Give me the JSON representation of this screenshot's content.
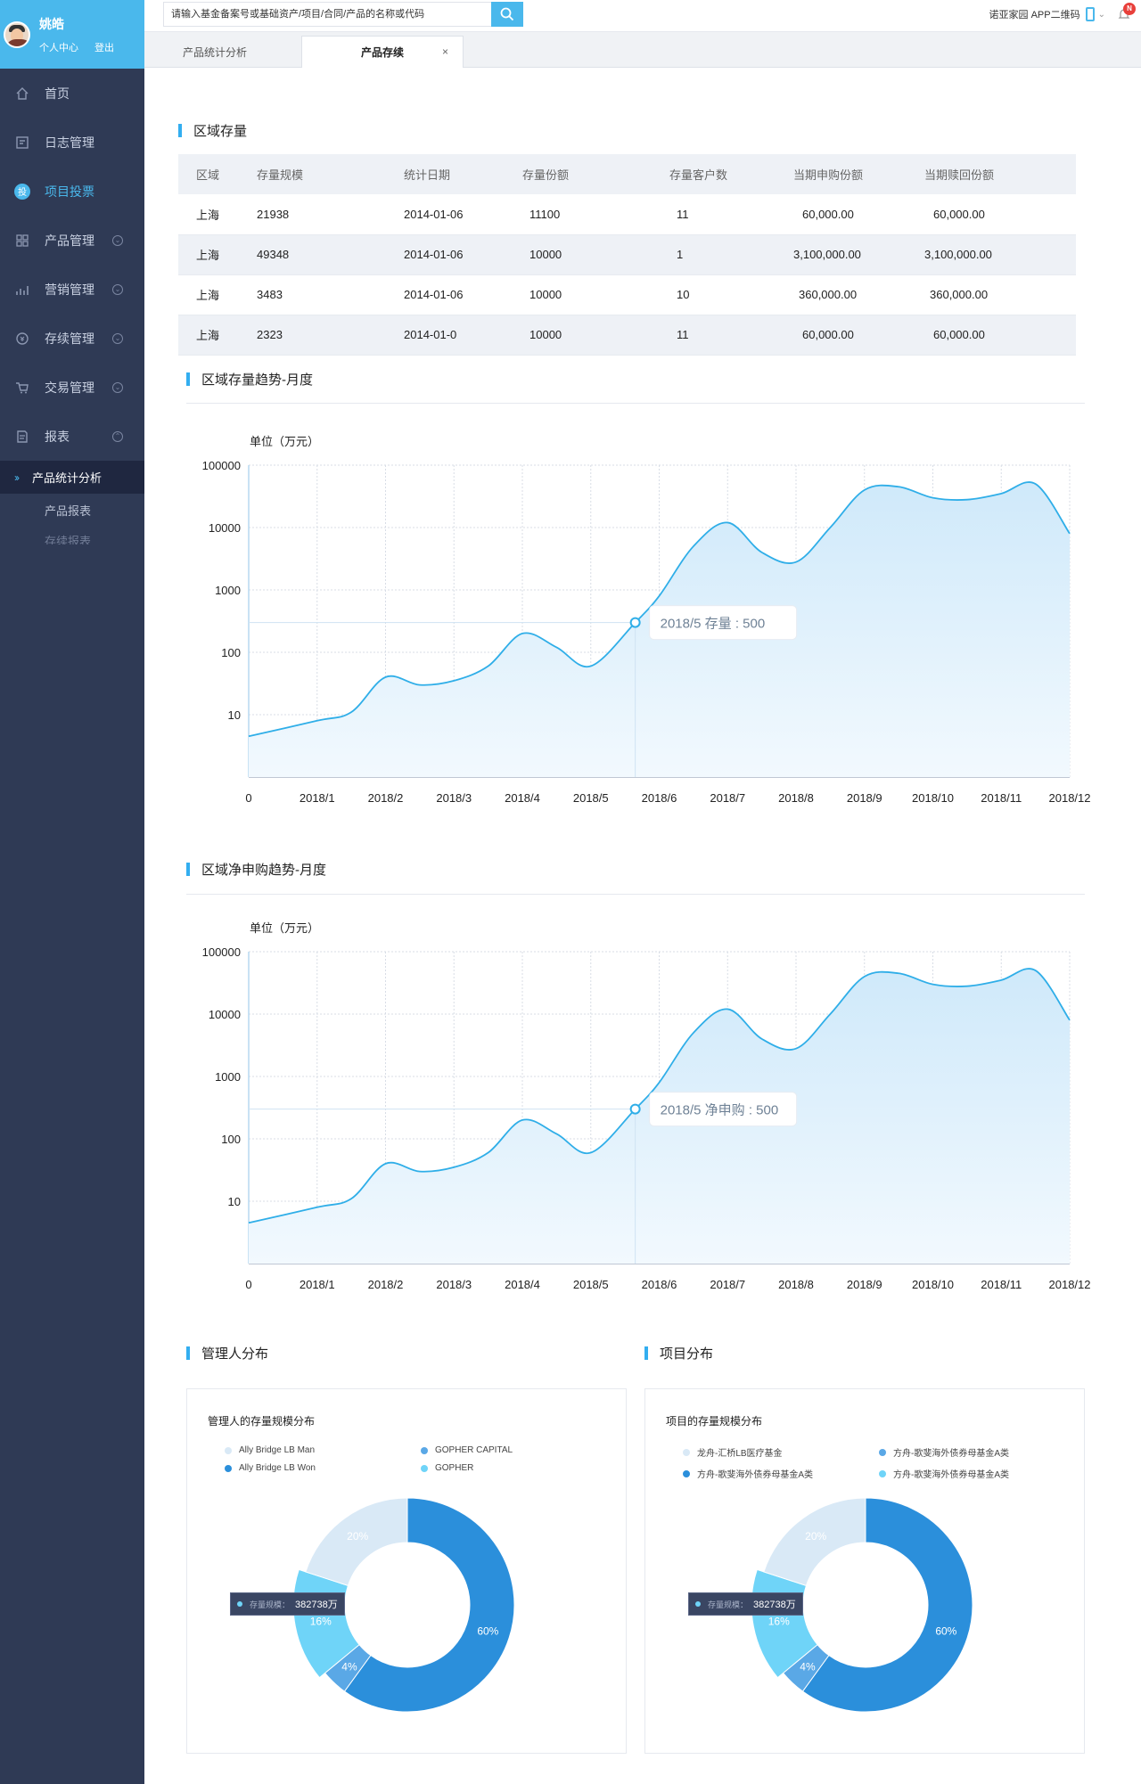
{
  "user": {
    "name": "姚皓",
    "center_link": "个人中心",
    "logout_link": "登出"
  },
  "sidebar": {
    "items": [
      {
        "label": "首页",
        "icon": "home-icon"
      },
      {
        "label": "日志管理",
        "icon": "log-icon"
      },
      {
        "label": "项目投票",
        "icon": "vote-icon",
        "active": true
      },
      {
        "label": "产品管理",
        "icon": "grid-icon"
      },
      {
        "label": "营销管理",
        "icon": "chart-icon"
      },
      {
        "label": "存续管理",
        "icon": "coin-icon"
      },
      {
        "label": "交易管理",
        "icon": "cart-icon"
      },
      {
        "label": "报表",
        "icon": "report-icon"
      }
    ],
    "subitems": [
      "产品统计分析",
      "产品报表",
      "存续报表"
    ]
  },
  "search": {
    "placeholder": "请输入基金备案号或基础资产/项目/合同/产品的名称或代码"
  },
  "topbar": {
    "qr_label": "诺亚家园 APP二维码",
    "notify_badge": "N"
  },
  "tabs": [
    {
      "label": "产品统计分析"
    },
    {
      "label": "产品存续",
      "active": true,
      "close": "×"
    }
  ],
  "region_table": {
    "title": "区域存量",
    "columns": [
      "区域",
      "存量规模",
      "统计日期",
      "存量份额",
      "存量客户数",
      "当期申购份额",
      "当期赎回份额"
    ],
    "rows": [
      [
        "上海",
        "21938",
        "2014-01-06",
        "11100",
        "11",
        "60,000.00",
        "60,000.00"
      ],
      [
        "上海",
        "49348",
        "2014-01-06",
        "10000",
        "1",
        "3,100,000.00",
        "3,100,000.00"
      ],
      [
        "上海",
        "3483",
        "2014-01-06",
        "10000",
        "10",
        "360,000.00",
        "360,000.00"
      ],
      [
        "上海",
        "2323",
        "2014-01-0",
        "10000",
        "11",
        "60,000.00",
        "60,000.00"
      ]
    ]
  },
  "chart_data": [
    {
      "type": "area",
      "title": "区域存量趋势-月度",
      "unit_label": "单位（万元）",
      "scale": "log",
      "ylim": [
        1,
        100000
      ],
      "y_ticks": [
        "100000",
        "10000",
        "1000",
        "100",
        "10"
      ],
      "x_labels": [
        "0",
        "2018/1",
        "2018/2",
        "2018/3",
        "2018/4",
        "2018/5",
        "2018/6",
        "2018/7",
        "2018/8",
        "2018/9",
        "2018/10",
        "2018/11",
        "2018/12"
      ],
      "x": [
        0,
        1,
        1.5,
        2,
        2.5,
        3,
        3.5,
        4,
        4.5,
        5,
        5.65,
        6,
        6.5,
        7,
        7.5,
        8,
        8.5,
        9,
        9.5,
        10,
        10.5,
        11,
        11.5,
        12
      ],
      "values": [
        4.5,
        8,
        11,
        40,
        30,
        35,
        60,
        200,
        120,
        60,
        300,
        800,
        5000,
        12000,
        4000,
        2800,
        10000,
        40000,
        45000,
        30000,
        28000,
        35000,
        50000,
        8000
      ],
      "highlight": {
        "x": 5.65,
        "y": 300,
        "label": "2018/5 存量 : 500"
      },
      "grid": true,
      "colors": {
        "line": "#2faee8",
        "fill_top": "#cfe9fa",
        "fill_bottom": "#f2f9fe"
      }
    },
    {
      "type": "area",
      "title": "区域净申购趋势-月度",
      "unit_label": "单位（万元）",
      "scale": "log",
      "ylim": [
        1,
        100000
      ],
      "y_ticks": [
        "100000",
        "10000",
        "1000",
        "100",
        "10"
      ],
      "x_labels": [
        "0",
        "2018/1",
        "2018/2",
        "2018/3",
        "2018/4",
        "2018/5",
        "2018/6",
        "2018/7",
        "2018/8",
        "2018/9",
        "2018/10",
        "2018/11",
        "2018/12"
      ],
      "x": [
        0,
        1,
        1.5,
        2,
        2.5,
        3,
        3.5,
        4,
        4.5,
        5,
        5.65,
        6,
        6.5,
        7,
        7.5,
        8,
        8.5,
        9,
        9.5,
        10,
        10.5,
        11,
        11.5,
        12
      ],
      "values": [
        4.5,
        8,
        11,
        40,
        30,
        35,
        60,
        200,
        120,
        60,
        300,
        800,
        5000,
        12000,
        4000,
        2800,
        10000,
        40000,
        45000,
        30000,
        28000,
        35000,
        50000,
        8000
      ],
      "highlight": {
        "x": 5.65,
        "y": 300,
        "label": "2018/5 净申购 : 500"
      },
      "grid": true,
      "colors": {
        "line": "#2faee8",
        "fill_top": "#cfe9fa",
        "fill_bottom": "#f2f9fe"
      }
    },
    {
      "type": "pie",
      "section_title": "管理人分布",
      "title": "管理人的存量规模分布",
      "legend": [
        "Ally Bridge LB Man",
        "GOPHER CAPITAL",
        "Ally Bridge LB Won",
        "GOPHER"
      ],
      "slices": [
        {
          "value": 60,
          "label": "60%",
          "color": "#2b8fdb"
        },
        {
          "value": 4,
          "label": "4%",
          "color": "#5aa8e6"
        },
        {
          "value": 16,
          "label": "16%",
          "color": "#6fd4f8"
        },
        {
          "value": 20,
          "label": "20%",
          "color": "#d9e9f6"
        }
      ],
      "legend_colors": [
        "#d9e9f6",
        "#5aa8e6",
        "#2b8fdb",
        "#6fd4f8"
      ],
      "tooltip": {
        "label": "存量规模：",
        "value": "382738万"
      }
    },
    {
      "type": "pie",
      "section_title": "项目分布",
      "title": "项目的存量规模分布",
      "legend": [
        "龙舟-汇桥LB医疗基金",
        "方舟-歌斐海外债券母基金A类",
        "方舟-歌斐海外债券母基金A类",
        "方舟-歌斐海外债券母基金A类"
      ],
      "slices": [
        {
          "value": 60,
          "label": "60%",
          "color": "#2b8fdb"
        },
        {
          "value": 4,
          "label": "4%",
          "color": "#5aa8e6"
        },
        {
          "value": 16,
          "label": "16%",
          "color": "#6fd4f8"
        },
        {
          "value": 20,
          "label": "20%",
          "color": "#d9e9f6"
        }
      ],
      "legend_colors": [
        "#d9e9f6",
        "#5aa8e6",
        "#2b8fdb",
        "#6fd4f8"
      ],
      "tooltip": {
        "label": "存量规模：",
        "value": "382738万"
      }
    }
  ]
}
